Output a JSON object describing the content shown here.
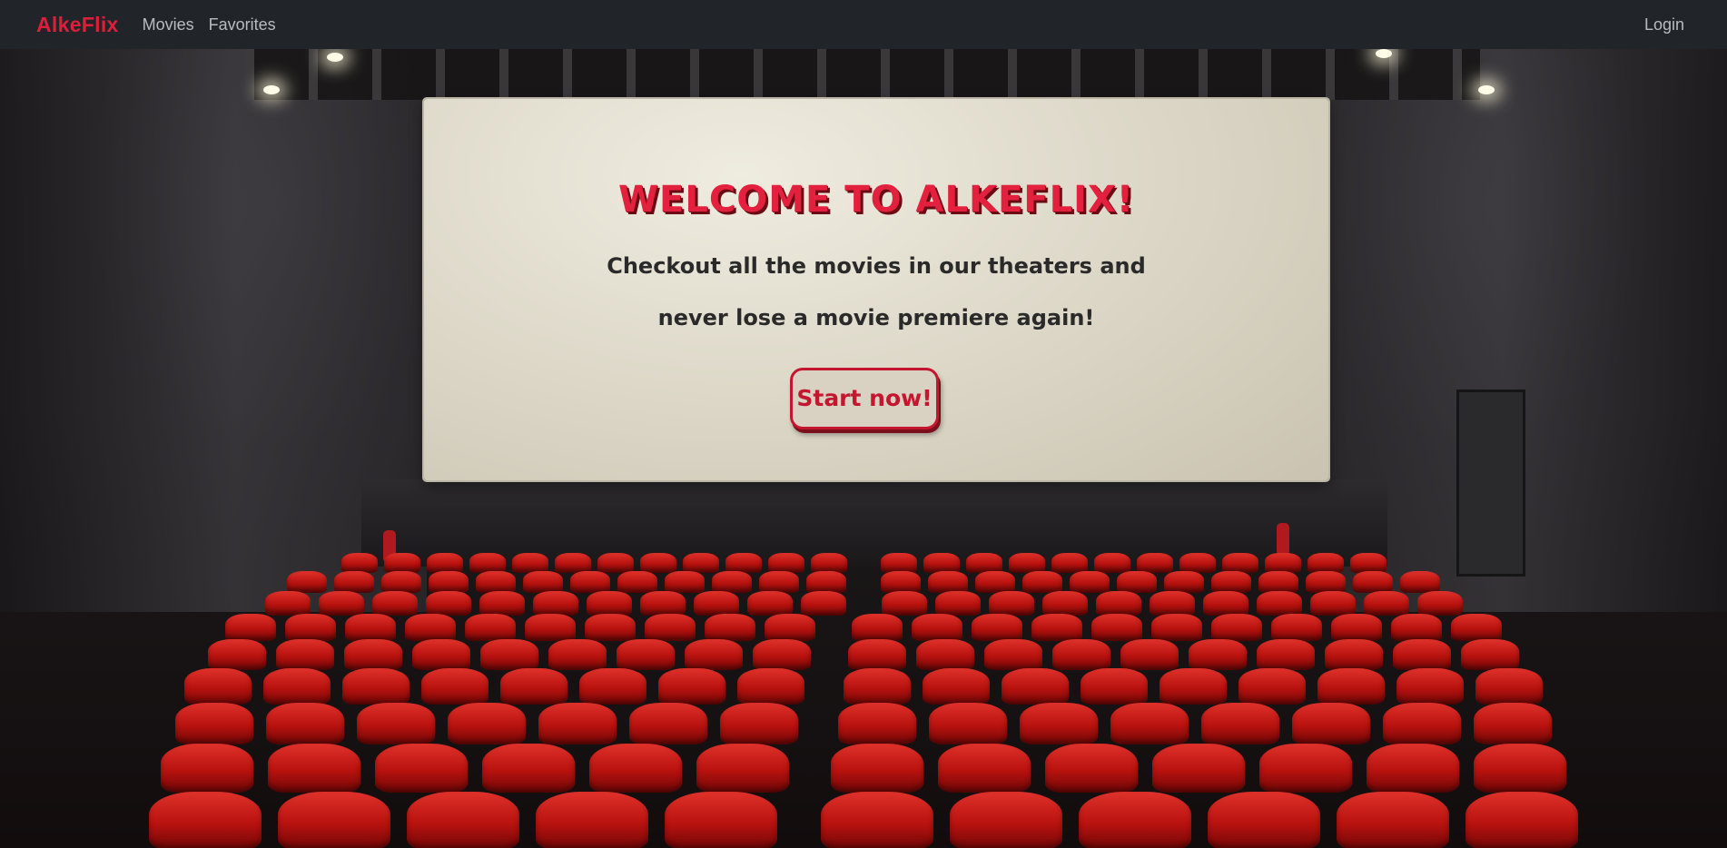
{
  "navbar": {
    "brand": "AlkeFlix",
    "links": [
      "Movies",
      "Favorites"
    ],
    "login": "Login"
  },
  "hero": {
    "title": "WELCOME TO ALKEFLIX!",
    "line1": "Checkout all the movies in our theaters and",
    "line2": "never lose a movie premiere again!",
    "cta": "Start now!"
  },
  "colors": {
    "brand": "#dc1f3a",
    "navbar_bg": "#212529",
    "nav_text": "#b9bcbf",
    "title": "#e3203d",
    "cta_border": "#c5162f",
    "seat_red": "#c8161a"
  },
  "background": {
    "image_description_icon": "cinema-theater-icon"
  }
}
